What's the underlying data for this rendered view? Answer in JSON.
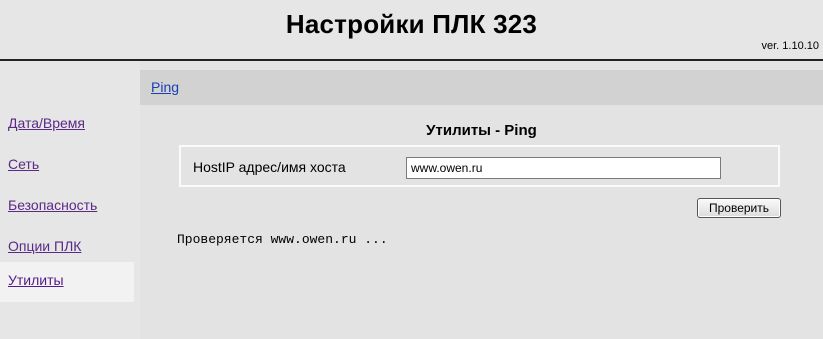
{
  "header": {
    "title": "Настройки ПЛК 323",
    "version": "ver. 1.10.10"
  },
  "sidebar": {
    "items": [
      {
        "label": "Дата/Время",
        "active": false
      },
      {
        "label": "Сеть",
        "active": false
      },
      {
        "label": "Безопасность",
        "active": false
      },
      {
        "label": "Опции ПЛК",
        "active": false
      },
      {
        "label": "Утилиты",
        "active": true
      }
    ]
  },
  "tabs": {
    "ping": "Ping"
  },
  "section": {
    "title": "Утилиты - Ping"
  },
  "form": {
    "host_label": "HostIP адрес/имя хоста",
    "host_value": "www.owen.ru",
    "check_button": "Проверить"
  },
  "status": {
    "text": "Проверяется www.owen.ru ..."
  },
  "colors": {
    "link": "#5b2a86",
    "tab_link": "#1a3fb5",
    "background": "#e6e6e6",
    "tab_bar": "#d2d2d2"
  }
}
